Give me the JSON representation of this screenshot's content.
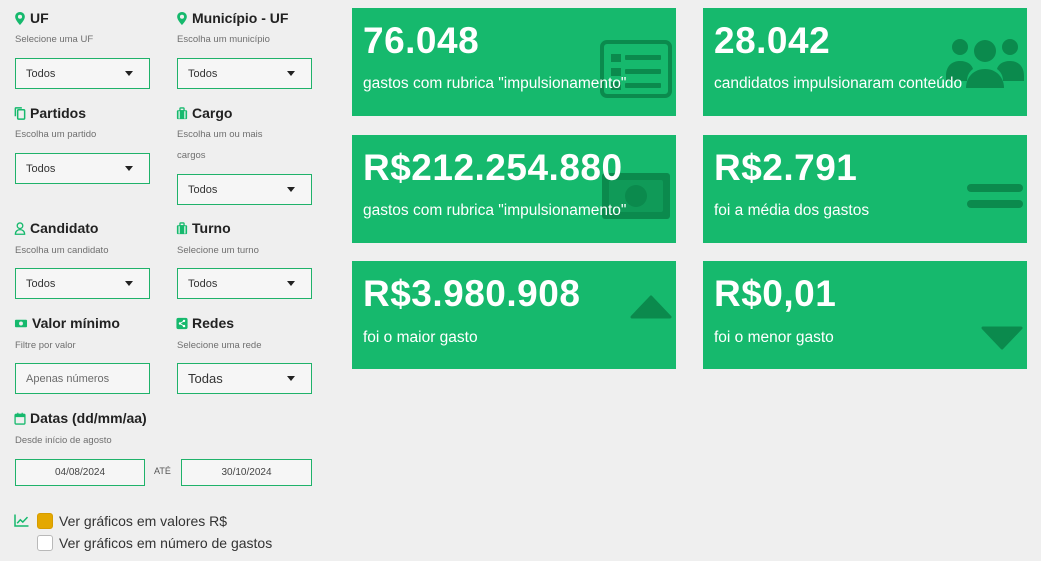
{
  "filters": {
    "uf": {
      "label": "UF",
      "hint": "Selecione uma UF",
      "value": "Todos",
      "icon": "map-pin-icon"
    },
    "municipio": {
      "label": "Município - UF",
      "hint": "Escolha um município",
      "value": "Todos",
      "icon": "map-pin-icon"
    },
    "partidos": {
      "label": "Partidos",
      "hint": "Escolha um partido",
      "value": "Todos",
      "icon": "copy-icon"
    },
    "cargo": {
      "label": "Cargo",
      "hint_line1": "Escolha um ou mais",
      "hint_line2": "cargos",
      "value": "Todos",
      "icon": "briefcase-icon"
    },
    "candidato": {
      "label": "Candidato",
      "hint": "Escolha um candidato",
      "value": "Todos",
      "icon": "user-icon"
    },
    "turno": {
      "label": "Turno",
      "hint": "Selecione um turno",
      "value": "Todos",
      "icon": "briefcase-icon"
    },
    "valor_minimo": {
      "label": "Valor mínimo",
      "hint": "Filtre por valor",
      "placeholder": "Apenas números",
      "icon": "money-icon"
    },
    "redes": {
      "label": "Redes",
      "hint": "Selecione uma rede",
      "value": "Todas",
      "icon": "share-icon"
    },
    "datas": {
      "label": "Datas (dd/mm/aa)",
      "hint": "Desde início de agosto",
      "start": "04/08/2024",
      "separator": "ATÉ",
      "end": "30/10/2024",
      "icon": "calendar-icon"
    }
  },
  "chart_toggle": {
    "icon": "line-chart-icon",
    "option_valores": {
      "label": "Ver gráficos em valores R$",
      "checked": true
    },
    "option_numero": {
      "label": "Ver gráficos em número de gastos",
      "checked": false
    }
  },
  "cards": [
    {
      "value": "76.048",
      "description": "gastos com rubrica \"impulsionamento\"",
      "icon": "receipt-icon"
    },
    {
      "value": "28.042",
      "description": "candidatos impulsionaram conteúdo",
      "icon": "users-icon"
    },
    {
      "value": "R$212.254.880",
      "description": "gastos com rubrica \"impulsionamento\"",
      "icon": "money-bill-icon"
    },
    {
      "value": "R$2.791",
      "description": "foi a média dos gastos",
      "icon": "equals-icon"
    },
    {
      "value": "R$3.980.908",
      "description": "foi o maior gasto",
      "icon": "triangle-up-icon"
    },
    {
      "value": "R$0,01",
      "description": "foi o menor gasto",
      "icon": "triangle-down-icon"
    }
  ],
  "colors": {
    "accent": "#16b96d",
    "border": "#1fb26a",
    "checkbox_on": "#e4a800",
    "icon_dark": "#0b8a4d"
  }
}
